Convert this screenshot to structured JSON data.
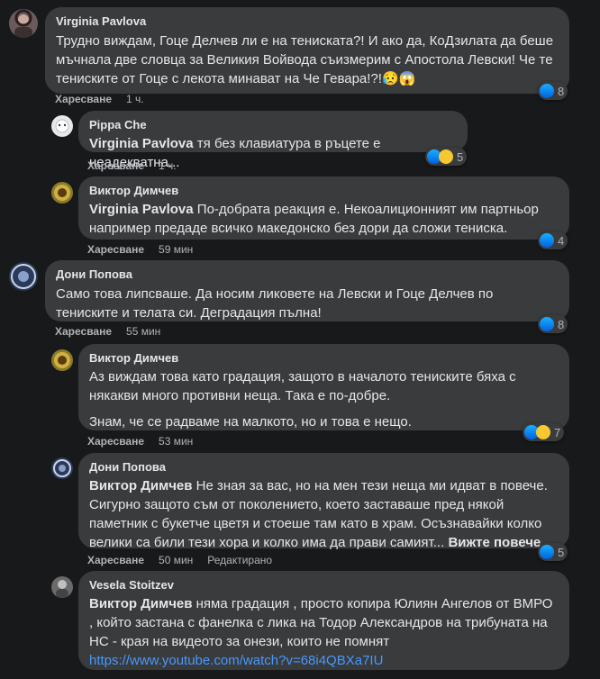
{
  "comments": [
    {
      "author": "Virginia Pavlova",
      "text": "Трудно виждам, Гоце Делчев ли е на тениската?! И ако да, КоДзилата да беше мъчнала две словца за Великия Войвода съизмерим с Апостола Левски! Че те тениските от Гоце с лекота минават на Че Гевара!?!😥😱",
      "like_label": "Харесване",
      "time": "1 ч.",
      "reaction_count": "8"
    },
    {
      "author": "Pippa Che",
      "mention": "Virginia Pavlova",
      "text": " тя без клавиатура в ръцете е неадекватна...",
      "like_label": "Харесване",
      "time": "1 ч.",
      "reaction_count": "5"
    },
    {
      "author": "Виктор Димчев",
      "mention": "Virginia Pavlova",
      "text": " По-добрата реакция е. Некоалиционният им партньор например предаде всичко македонско без дори да сложи тениска.",
      "like_label": "Харесване",
      "time": "59 мин",
      "reaction_count": "4"
    },
    {
      "author": "Дони Попова",
      "text": "Само това липсваше. Да носим ликовете на Левски и Гоце Делчев по тениските и телата си. Деградация пълна!",
      "like_label": "Харесване",
      "time": "55 мин",
      "reaction_count": "8"
    },
    {
      "author": "Виктор Димчев",
      "text": "Аз виждам това като градация, защото в началото тениските бяха с някакви много противни неща. Така е по-добре.",
      "text2": "Знам, че се радваме на малкото, но и това е нещо.",
      "like_label": "Харесване",
      "time": "53 мин",
      "reaction_count": "7"
    },
    {
      "author": "Дони Попова",
      "mention": "Виктор Димчев",
      "text": " Не зная за вас, но на мен тези неща ми идват в повече. Сигурно защото съм от поколението, което заставаше пред някой паметник с букетче цветя и стоеше там като в храм. Осъзнавайки колко велики са били тези хора и колко има да прави самият... ",
      "see_more": "Вижте повече",
      "like_label": "Харесване",
      "time": "50 мин",
      "edited": "Редактирано",
      "reaction_count": "5"
    },
    {
      "author": "Vesela Stoitzev",
      "mention": "Виктор Димчев",
      "text": " няма градация , просто копира Юлиян Ангелов от ВМРО , който застана с фанелка с лика на Тодор Александров на трибуната на НС - края на видеото за онези, които не помнят",
      "link": "https://www.youtube.com/watch?v=68i4QBXa7IU"
    }
  ]
}
